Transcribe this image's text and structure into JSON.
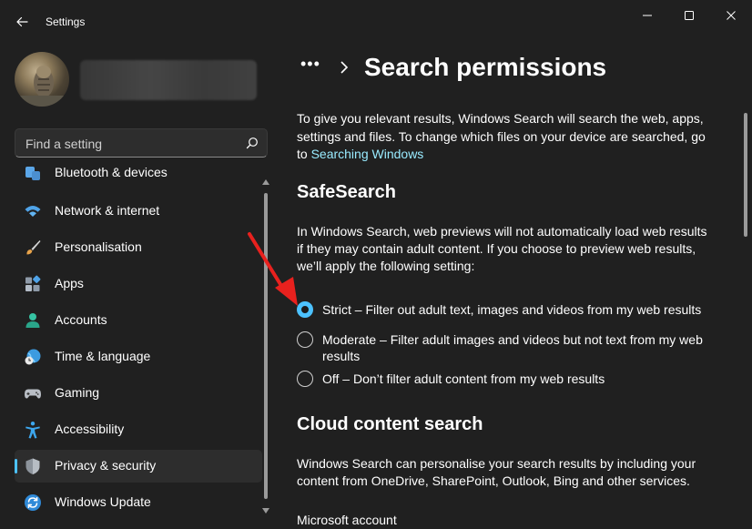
{
  "window": {
    "title": "Settings"
  },
  "sidebar": {
    "search_placeholder": "Find a setting",
    "items": [
      {
        "label": "Bluetooth & devices",
        "icon": "bluetooth-icon"
      },
      {
        "label": "Network & internet",
        "icon": "wifi-icon"
      },
      {
        "label": "Personalisation",
        "icon": "brush-icon"
      },
      {
        "label": "Apps",
        "icon": "apps-icon"
      },
      {
        "label": "Accounts",
        "icon": "person-icon"
      },
      {
        "label": "Time & language",
        "icon": "globe-clock-icon"
      },
      {
        "label": "Gaming",
        "icon": "gamepad-icon"
      },
      {
        "label": "Accessibility",
        "icon": "accessibility-icon"
      },
      {
        "label": "Privacy & security",
        "icon": "shield-icon",
        "selected": true
      },
      {
        "label": "Windows Update",
        "icon": "update-icon"
      }
    ]
  },
  "main": {
    "breadcrumb_more": "•••",
    "title": "Search permissions",
    "intro_text": "To give you relevant results, Windows Search will search the web, apps, settings and files. To change which files on your device are searched, go to",
    "intro_link": "Searching Windows",
    "safesearch": {
      "heading": "SafeSearch",
      "description": "In Windows Search, web previews will not automatically load web results if they may contain adult content. If you choose to preview web results, we’ll apply the following setting:",
      "options": [
        {
          "label": "Strict – Filter out adult text, images and videos from my web results",
          "checked": true
        },
        {
          "label": "Moderate – Filter adult images and videos but not text from my web results",
          "checked": false
        },
        {
          "label": "Off – Don’t filter adult content from my web results",
          "checked": false
        }
      ]
    },
    "cloud": {
      "heading": "Cloud content search",
      "description": "Windows Search can personalise your search results by including your content from OneDrive, SharePoint, Outlook, Bing and other services.",
      "subheading": "Microsoft account"
    }
  },
  "colors": {
    "background": "#202020",
    "accent": "#4cc2ff",
    "link": "#99ebff",
    "annotation": "#e8211e"
  }
}
